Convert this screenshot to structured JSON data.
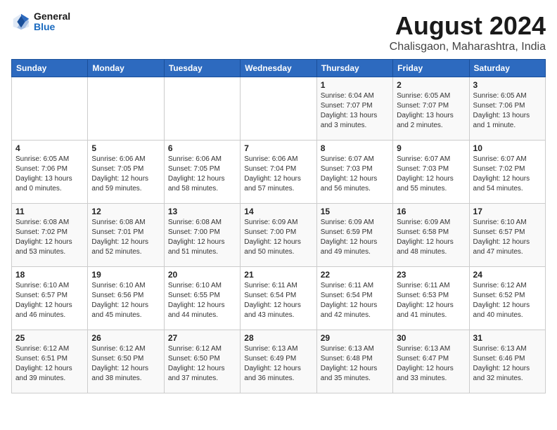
{
  "header": {
    "logo_line1": "General",
    "logo_line2": "Blue",
    "title": "August 2024",
    "subtitle": "Chalisgaon, Maharashtra, India"
  },
  "weekdays": [
    "Sunday",
    "Monday",
    "Tuesday",
    "Wednesday",
    "Thursday",
    "Friday",
    "Saturday"
  ],
  "weeks": [
    [
      {
        "day": "",
        "info": ""
      },
      {
        "day": "",
        "info": ""
      },
      {
        "day": "",
        "info": ""
      },
      {
        "day": "",
        "info": ""
      },
      {
        "day": "1",
        "info": "Sunrise: 6:04 AM\nSunset: 7:07 PM\nDaylight: 13 hours\nand 3 minutes."
      },
      {
        "day": "2",
        "info": "Sunrise: 6:05 AM\nSunset: 7:07 PM\nDaylight: 13 hours\nand 2 minutes."
      },
      {
        "day": "3",
        "info": "Sunrise: 6:05 AM\nSunset: 7:06 PM\nDaylight: 13 hours\nand 1 minute."
      }
    ],
    [
      {
        "day": "4",
        "info": "Sunrise: 6:05 AM\nSunset: 7:06 PM\nDaylight: 13 hours\nand 0 minutes."
      },
      {
        "day": "5",
        "info": "Sunrise: 6:06 AM\nSunset: 7:05 PM\nDaylight: 12 hours\nand 59 minutes."
      },
      {
        "day": "6",
        "info": "Sunrise: 6:06 AM\nSunset: 7:05 PM\nDaylight: 12 hours\nand 58 minutes."
      },
      {
        "day": "7",
        "info": "Sunrise: 6:06 AM\nSunset: 7:04 PM\nDaylight: 12 hours\nand 57 minutes."
      },
      {
        "day": "8",
        "info": "Sunrise: 6:07 AM\nSunset: 7:03 PM\nDaylight: 12 hours\nand 56 minutes."
      },
      {
        "day": "9",
        "info": "Sunrise: 6:07 AM\nSunset: 7:03 PM\nDaylight: 12 hours\nand 55 minutes."
      },
      {
        "day": "10",
        "info": "Sunrise: 6:07 AM\nSunset: 7:02 PM\nDaylight: 12 hours\nand 54 minutes."
      }
    ],
    [
      {
        "day": "11",
        "info": "Sunrise: 6:08 AM\nSunset: 7:02 PM\nDaylight: 12 hours\nand 53 minutes."
      },
      {
        "day": "12",
        "info": "Sunrise: 6:08 AM\nSunset: 7:01 PM\nDaylight: 12 hours\nand 52 minutes."
      },
      {
        "day": "13",
        "info": "Sunrise: 6:08 AM\nSunset: 7:00 PM\nDaylight: 12 hours\nand 51 minutes."
      },
      {
        "day": "14",
        "info": "Sunrise: 6:09 AM\nSunset: 7:00 PM\nDaylight: 12 hours\nand 50 minutes."
      },
      {
        "day": "15",
        "info": "Sunrise: 6:09 AM\nSunset: 6:59 PM\nDaylight: 12 hours\nand 49 minutes."
      },
      {
        "day": "16",
        "info": "Sunrise: 6:09 AM\nSunset: 6:58 PM\nDaylight: 12 hours\nand 48 minutes."
      },
      {
        "day": "17",
        "info": "Sunrise: 6:10 AM\nSunset: 6:57 PM\nDaylight: 12 hours\nand 47 minutes."
      }
    ],
    [
      {
        "day": "18",
        "info": "Sunrise: 6:10 AM\nSunset: 6:57 PM\nDaylight: 12 hours\nand 46 minutes."
      },
      {
        "day": "19",
        "info": "Sunrise: 6:10 AM\nSunset: 6:56 PM\nDaylight: 12 hours\nand 45 minutes."
      },
      {
        "day": "20",
        "info": "Sunrise: 6:10 AM\nSunset: 6:55 PM\nDaylight: 12 hours\nand 44 minutes."
      },
      {
        "day": "21",
        "info": "Sunrise: 6:11 AM\nSunset: 6:54 PM\nDaylight: 12 hours\nand 43 minutes."
      },
      {
        "day": "22",
        "info": "Sunrise: 6:11 AM\nSunset: 6:54 PM\nDaylight: 12 hours\nand 42 minutes."
      },
      {
        "day": "23",
        "info": "Sunrise: 6:11 AM\nSunset: 6:53 PM\nDaylight: 12 hours\nand 41 minutes."
      },
      {
        "day": "24",
        "info": "Sunrise: 6:12 AM\nSunset: 6:52 PM\nDaylight: 12 hours\nand 40 minutes."
      }
    ],
    [
      {
        "day": "25",
        "info": "Sunrise: 6:12 AM\nSunset: 6:51 PM\nDaylight: 12 hours\nand 39 minutes."
      },
      {
        "day": "26",
        "info": "Sunrise: 6:12 AM\nSunset: 6:50 PM\nDaylight: 12 hours\nand 38 minutes."
      },
      {
        "day": "27",
        "info": "Sunrise: 6:12 AM\nSunset: 6:50 PM\nDaylight: 12 hours\nand 37 minutes."
      },
      {
        "day": "28",
        "info": "Sunrise: 6:13 AM\nSunset: 6:49 PM\nDaylight: 12 hours\nand 36 minutes."
      },
      {
        "day": "29",
        "info": "Sunrise: 6:13 AM\nSunset: 6:48 PM\nDaylight: 12 hours\nand 35 minutes."
      },
      {
        "day": "30",
        "info": "Sunrise: 6:13 AM\nSunset: 6:47 PM\nDaylight: 12 hours\nand 33 minutes."
      },
      {
        "day": "31",
        "info": "Sunrise: 6:13 AM\nSunset: 6:46 PM\nDaylight: 12 hours\nand 32 minutes."
      }
    ]
  ]
}
